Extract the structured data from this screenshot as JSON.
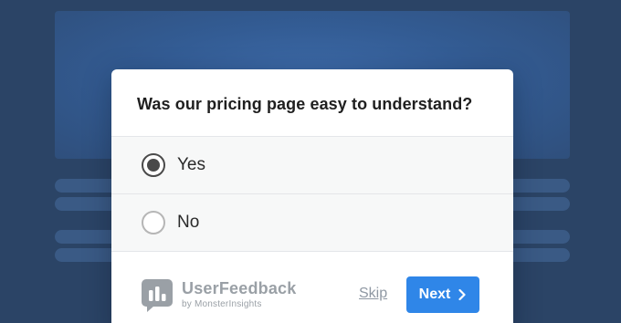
{
  "survey": {
    "question": "Was our pricing page easy to understand?",
    "options": [
      {
        "label": "Yes",
        "selected": true
      },
      {
        "label": "No",
        "selected": false
      }
    ]
  },
  "footer": {
    "brand_name": "UserFeedback",
    "brand_sub": "by MonsterInsights",
    "brand_icon": "userfeedback-logo-icon",
    "skip_label": "Skip",
    "next_label": "Next",
    "next_icon": "chevron-right-icon"
  },
  "colors": {
    "background": "#2b4466",
    "accent": "#2f86e8",
    "radio_selected": "#4a4a4a"
  }
}
